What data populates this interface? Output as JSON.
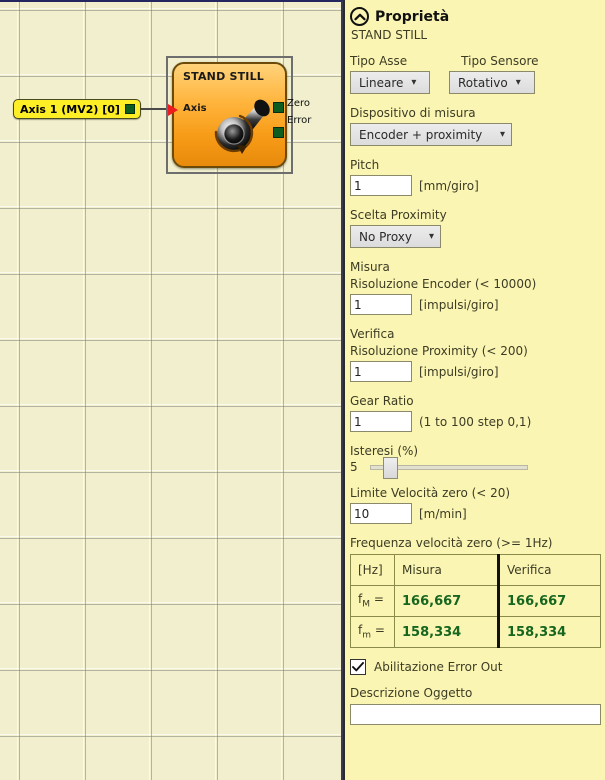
{
  "canvas": {
    "axis_tag": {
      "label": "Axis 1 (MV2) [0]"
    },
    "block": {
      "title": "STAND STILL",
      "input_label": "Axis",
      "outputs": [
        {
          "label": "Zero"
        },
        {
          "label": "Error"
        }
      ]
    }
  },
  "panel": {
    "title": "Proprietà",
    "subtitle": "STAND STILL",
    "collapse_icon": "chevron-up-icon",
    "fields": {
      "tipo_asse": {
        "label": "Tipo Asse",
        "value": "Lineare"
      },
      "tipo_sensore": {
        "label": "Tipo Sensore",
        "value": "Rotativo"
      },
      "dispositivo": {
        "label": "Dispositivo di misura",
        "value": "Encoder + proximity"
      },
      "pitch": {
        "label": "Pitch",
        "value": "1",
        "unit": "[mm/giro]"
      },
      "scelta_proximity": {
        "label": "Scelta Proximity",
        "value": "No Proxy"
      },
      "misura_group": "Misura",
      "risoluzione_encoder": {
        "label": "Risoluzione Encoder  (< 10000)",
        "value": "1",
        "unit": "[impulsi/giro]"
      },
      "verifica_group": "Verifica",
      "risoluzione_proximity": {
        "label": "Risoluzione Proximity  (< 200)",
        "value": "1",
        "unit": "[impulsi/giro]"
      },
      "gear_ratio": {
        "label": "Gear Ratio",
        "value": "1",
        "unit": "(1 to 100 step 0,1)"
      },
      "isteresi": {
        "label": "Isteresi (%)",
        "value": "5"
      },
      "limite_velocita": {
        "label": "Limite Velocità zero  (< 20)",
        "value": "10",
        "unit": "[m/min]"
      },
      "frequenza_label": "Frequenza velocità zero (>= 1Hz)",
      "error_out": {
        "label": "Abilitazione Error Out",
        "checked": "true"
      },
      "descrizione": {
        "label": "Descrizione Oggetto",
        "value": ""
      }
    },
    "freq_table": {
      "headers": [
        "[Hz]",
        "Misura",
        "Verifica"
      ],
      "rows": [
        {
          "name_main": "f",
          "name_sub": "M",
          "name_eq": "=",
          "misura": "166,667",
          "verifica": "166,667"
        },
        {
          "name_main": "f",
          "name_sub": "m",
          "name_eq": "=",
          "misura": "158,334",
          "verifica": "158,334"
        }
      ]
    }
  },
  "colors": {
    "panel_bg": "#fbf5b4",
    "canvas_bg": "#f1efcd",
    "block_orange": "#ffb43c",
    "tag_yellow": "#fdee25",
    "port_green": "#0d5c20",
    "value_green": "#15661f",
    "input_arrow_red": "#ee1c1c"
  }
}
